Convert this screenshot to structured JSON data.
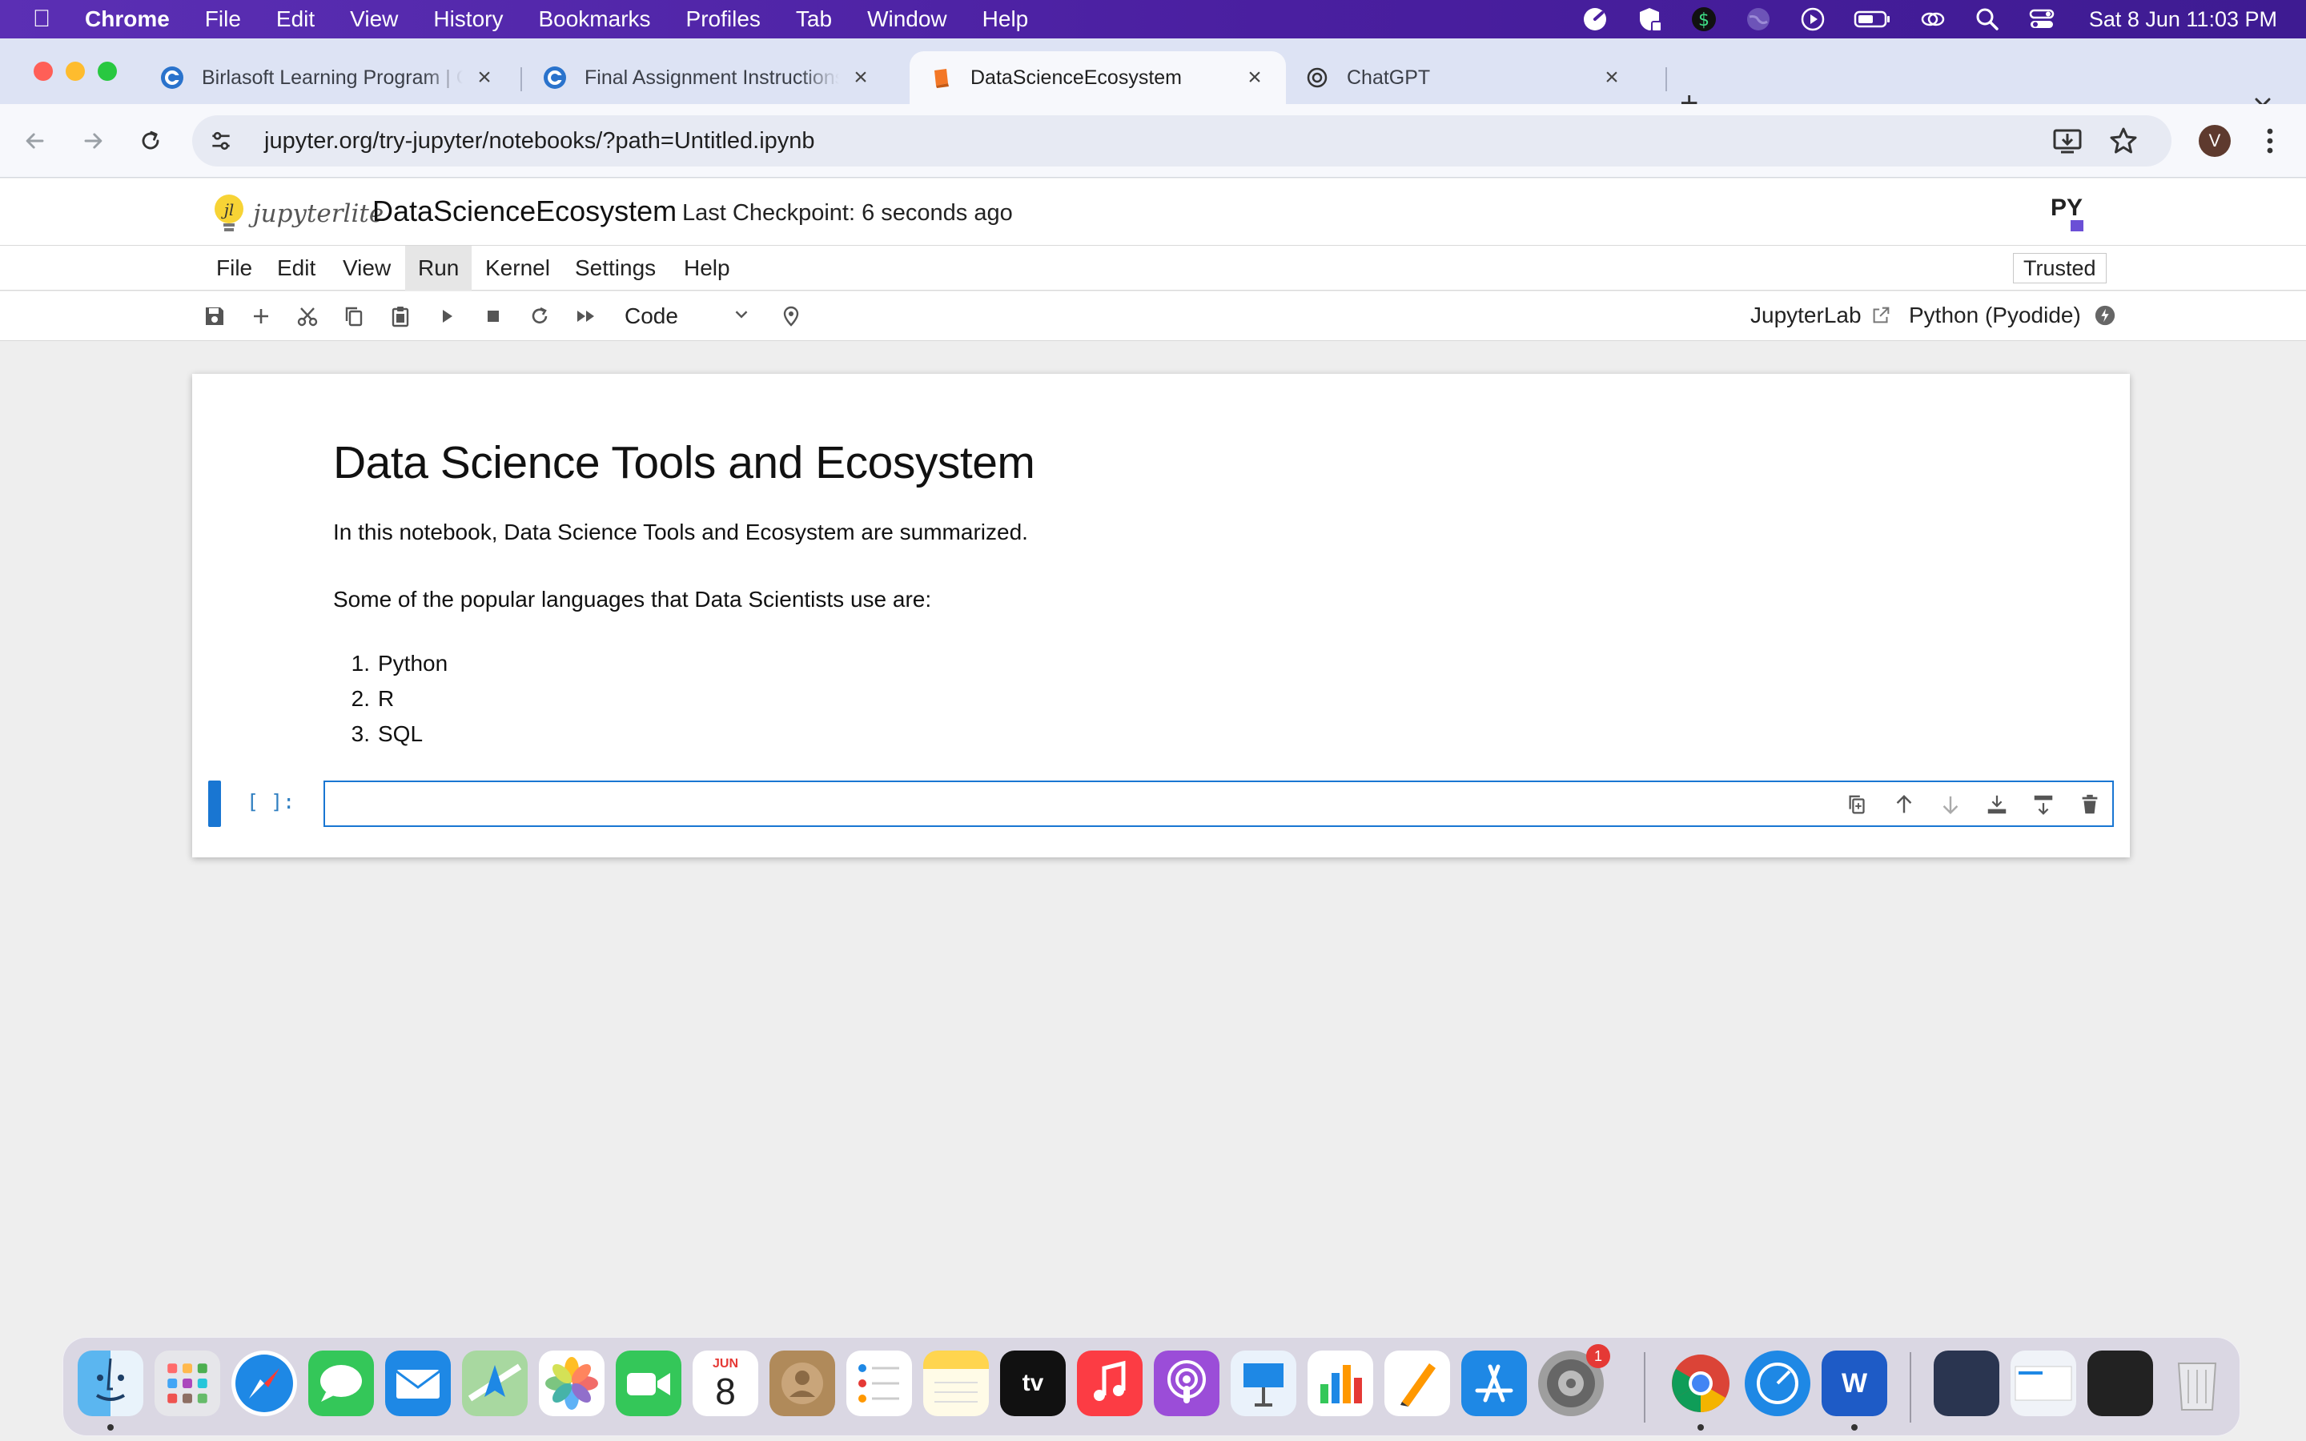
{
  "menubar": {
    "app_name": "Chrome",
    "items": [
      "File",
      "Edit",
      "View",
      "History",
      "Bookmarks",
      "Profiles",
      "Tab",
      "Window",
      "Help"
    ],
    "clock": "Sat 8 Jun  11:03 PM"
  },
  "tabs": [
    {
      "title": "Birlasoft Learning Program | C",
      "icon": "coursera-favicon"
    },
    {
      "title": "Final Assignment Instructions",
      "icon": "coursera-favicon"
    },
    {
      "title": "DataScienceEcosystem",
      "icon": "jupyter-book-favicon",
      "active": true
    },
    {
      "title": "ChatGPT",
      "icon": "chatgpt-favicon"
    }
  ],
  "address_bar": {
    "url": "jupyter.org/try-jupyter/notebooks/?path=Untitled.ipynb"
  },
  "profile": {
    "initial": "V"
  },
  "jupyter": {
    "logo_text": "jupyterlite",
    "notebook_title": "DataScienceEcosystem",
    "checkpoint": "Last Checkpoint: 6 seconds ago",
    "menu": [
      "File",
      "Edit",
      "View",
      "Run",
      "Kernel",
      "Settings",
      "Help"
    ],
    "active_menu": "Run",
    "trusted": "Trusted",
    "cell_type": "Code",
    "jupyterlab_link": "JupyterLab",
    "kernel": "Python (Pyodide)"
  },
  "notebook": {
    "heading": "Data Science Tools and Ecosystem",
    "intro": "In this notebook, Data Science Tools and Ecosystem are summarized.",
    "languages_intro": "Some of the popular languages that Data Scientists use are:",
    "languages": [
      {
        "num": "1.",
        "name": "Python"
      },
      {
        "num": "2.",
        "name": "R"
      },
      {
        "num": "3.",
        "name": "SQL"
      }
    ],
    "code_prompt": "[ ]:",
    "code_value": ""
  },
  "dock": {
    "calendar_month": "JUN",
    "calendar_day": "8",
    "tv_label": "tv",
    "settings_badge": "1",
    "apps": [
      "Finder",
      "Launchpad",
      "Safari",
      "Messages",
      "Mail",
      "Maps",
      "Photos",
      "FaceTime",
      "Calendar",
      "Contacts",
      "Reminders",
      "Notes",
      "TV",
      "Music",
      "Podcasts",
      "Keynote",
      "Numbers",
      "Pages",
      "App Store",
      "System Settings",
      "Chrome",
      "Mosaic",
      "Word"
    ]
  },
  "colors": {
    "menubar": "#4a1fa0",
    "accent_blue": "#1976d2",
    "tab_strip": "#dde3f4",
    "notebook_bg": "#eeeeee"
  }
}
